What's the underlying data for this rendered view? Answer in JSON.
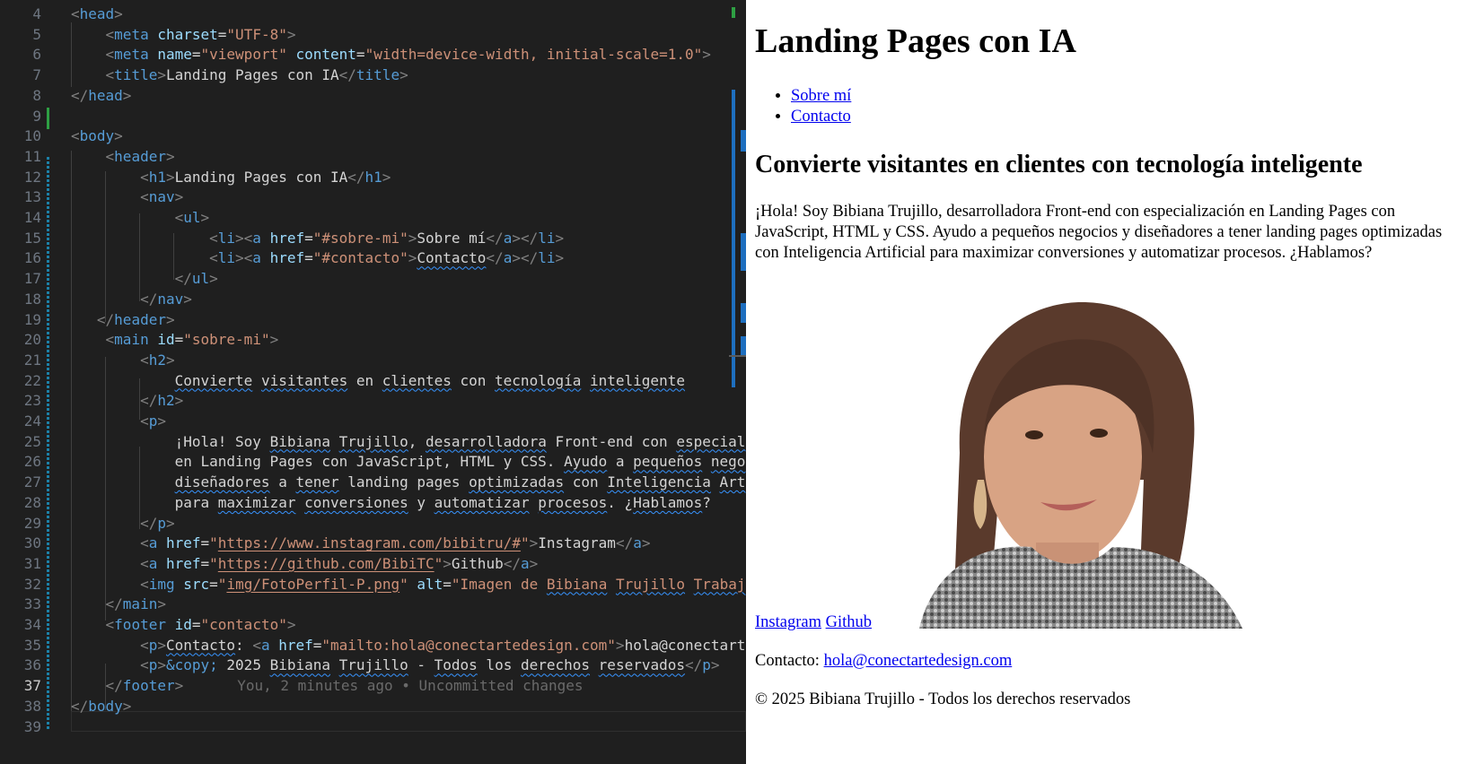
{
  "editor": {
    "active_line": "37",
    "blame": "You, 2 minutes ago • Uncommitted changes",
    "lines": [
      {
        "n": "4",
        "tokens": [
          [
            "t",
            "<"
          ],
          [
            "tn",
            "head"
          ],
          [
            "t",
            ">"
          ]
        ]
      },
      {
        "n": "5",
        "tokens": [
          [
            "tx",
            "    "
          ],
          [
            "t",
            "<"
          ],
          [
            "tn",
            "meta"
          ],
          [
            "tx",
            " "
          ],
          [
            "an",
            "charset"
          ],
          [
            "tx",
            "="
          ],
          [
            "av",
            "\"UTF-8\""
          ],
          [
            "t",
            ">"
          ]
        ]
      },
      {
        "n": "6",
        "tokens": [
          [
            "tx",
            "    "
          ],
          [
            "t",
            "<"
          ],
          [
            "tn",
            "meta"
          ],
          [
            "tx",
            " "
          ],
          [
            "an",
            "name"
          ],
          [
            "tx",
            "="
          ],
          [
            "av",
            "\"viewport\""
          ],
          [
            "tx",
            " "
          ],
          [
            "an",
            "content"
          ],
          [
            "tx",
            "="
          ],
          [
            "av",
            "\"width=device-width, initial-scale=1.0\""
          ],
          [
            "t",
            ">"
          ]
        ]
      },
      {
        "n": "7",
        "tokens": [
          [
            "tx",
            "    "
          ],
          [
            "t",
            "<"
          ],
          [
            "tn",
            "title"
          ],
          [
            "t",
            ">"
          ],
          [
            "tx",
            "Landing Pages con IA"
          ],
          [
            "t",
            "</"
          ],
          [
            "tn",
            "title"
          ],
          [
            "t",
            ">"
          ]
        ]
      },
      {
        "n": "8",
        "tokens": [
          [
            "t",
            "</"
          ],
          [
            "tn",
            "head"
          ],
          [
            "t",
            ">"
          ]
        ]
      },
      {
        "n": "9",
        "tokens": []
      },
      {
        "n": "10",
        "tokens": [
          [
            "t",
            "<"
          ],
          [
            "tn",
            "body"
          ],
          [
            "t",
            ">"
          ]
        ]
      },
      {
        "n": "11",
        "tokens": [
          [
            "tx",
            "    "
          ],
          [
            "t",
            "<"
          ],
          [
            "tn",
            "header"
          ],
          [
            "t",
            ">"
          ]
        ]
      },
      {
        "n": "12",
        "tokens": [
          [
            "tx",
            "        "
          ],
          [
            "t",
            "<"
          ],
          [
            "tn",
            "h1"
          ],
          [
            "t",
            ">"
          ],
          [
            "tx",
            "Landing Pages con IA"
          ],
          [
            "t",
            "</"
          ],
          [
            "tn",
            "h1"
          ],
          [
            "t",
            ">"
          ]
        ]
      },
      {
        "n": "13",
        "tokens": [
          [
            "tx",
            "        "
          ],
          [
            "t",
            "<"
          ],
          [
            "tn",
            "nav"
          ],
          [
            "t",
            ">"
          ]
        ]
      },
      {
        "n": "14",
        "tokens": [
          [
            "tx",
            "            "
          ],
          [
            "t",
            "<"
          ],
          [
            "tn",
            "ul"
          ],
          [
            "t",
            ">"
          ]
        ]
      },
      {
        "n": "15",
        "tokens": [
          [
            "tx",
            "                "
          ],
          [
            "t",
            "<"
          ],
          [
            "tn",
            "li"
          ],
          [
            "t",
            "><"
          ],
          [
            "tn",
            "a"
          ],
          [
            "tx",
            " "
          ],
          [
            "an",
            "href"
          ],
          [
            "tx",
            "="
          ],
          [
            "av",
            "\"#sobre-mi\""
          ],
          [
            "t",
            ">"
          ],
          [
            "tx",
            "Sobre mí"
          ],
          [
            "t",
            "</"
          ],
          [
            "tn",
            "a"
          ],
          [
            "t",
            "></"
          ],
          [
            "tn",
            "li"
          ],
          [
            "t",
            ">"
          ]
        ]
      },
      {
        "n": "16",
        "tokens": [
          [
            "tx",
            "                "
          ],
          [
            "t",
            "<"
          ],
          [
            "tn",
            "li"
          ],
          [
            "t",
            "><"
          ],
          [
            "tn",
            "a"
          ],
          [
            "tx",
            " "
          ],
          [
            "an",
            "href"
          ],
          [
            "tx",
            "="
          ],
          [
            "av",
            "\"#contacto\""
          ],
          [
            "t",
            ">"
          ],
          [
            "sq",
            "Contacto"
          ],
          [
            "t",
            "</"
          ],
          [
            "tn",
            "a"
          ],
          [
            "t",
            "></"
          ],
          [
            "tn",
            "li"
          ],
          [
            "t",
            ">"
          ]
        ]
      },
      {
        "n": "17",
        "tokens": [
          [
            "tx",
            "            "
          ],
          [
            "t",
            "</"
          ],
          [
            "tn",
            "ul"
          ],
          [
            "t",
            ">"
          ]
        ]
      },
      {
        "n": "18",
        "tokens": [
          [
            "tx",
            "        "
          ],
          [
            "t",
            "</"
          ],
          [
            "tn",
            "nav"
          ],
          [
            "t",
            ">"
          ]
        ]
      },
      {
        "n": "19",
        "tokens": [
          [
            "tx",
            "   "
          ],
          [
            "t",
            "</"
          ],
          [
            "tn",
            "header"
          ],
          [
            "t",
            ">"
          ]
        ]
      },
      {
        "n": "20",
        "tokens": [
          [
            "tx",
            "    "
          ],
          [
            "t",
            "<"
          ],
          [
            "tn",
            "main"
          ],
          [
            "tx",
            " "
          ],
          [
            "an",
            "id"
          ],
          [
            "tx",
            "="
          ],
          [
            "av",
            "\"sobre-mi\""
          ],
          [
            "t",
            ">"
          ]
        ]
      },
      {
        "n": "21",
        "tokens": [
          [
            "tx",
            "        "
          ],
          [
            "t",
            "<"
          ],
          [
            "tn",
            "h2"
          ],
          [
            "t",
            ">"
          ]
        ]
      },
      {
        "n": "22",
        "tokens": [
          [
            "tx",
            "            "
          ],
          [
            "sq",
            "Convierte"
          ],
          [
            "tx",
            " "
          ],
          [
            "sq",
            "visitantes"
          ],
          [
            "tx",
            " en "
          ],
          [
            "sq",
            "clientes"
          ],
          [
            "tx",
            " con "
          ],
          [
            "sq",
            "tecnología"
          ],
          [
            "tx",
            " "
          ],
          [
            "sq",
            "inteligente"
          ]
        ]
      },
      {
        "n": "23",
        "tokens": [
          [
            "tx",
            "        "
          ],
          [
            "t",
            "</"
          ],
          [
            "tn",
            "h2"
          ],
          [
            "t",
            ">"
          ]
        ]
      },
      {
        "n": "24",
        "tokens": [
          [
            "tx",
            "        "
          ],
          [
            "t",
            "<"
          ],
          [
            "tn",
            "p"
          ],
          [
            "t",
            ">"
          ]
        ]
      },
      {
        "n": "25",
        "tokens": [
          [
            "tx",
            "            ¡Hola! Soy "
          ],
          [
            "sq",
            "Bibiana"
          ],
          [
            "tx",
            " "
          ],
          [
            "sq",
            "Trujillo"
          ],
          [
            "tx",
            ", "
          ],
          [
            "sq",
            "desarrolladora"
          ],
          [
            "tx",
            " Front-end con "
          ],
          [
            "sq",
            "especial"
          ]
        ]
      },
      {
        "n": "26",
        "tokens": [
          [
            "tx",
            "            en Landing Pages con JavaScript, HTML y CSS. "
          ],
          [
            "sq",
            "Ayudo"
          ],
          [
            "tx",
            " a "
          ],
          [
            "sq",
            "pequeños"
          ],
          [
            "tx",
            " "
          ],
          [
            "sq",
            "nego"
          ]
        ]
      },
      {
        "n": "27",
        "tokens": [
          [
            "tx",
            "            "
          ],
          [
            "sq",
            "diseñadores"
          ],
          [
            "tx",
            " a "
          ],
          [
            "sq",
            "tener"
          ],
          [
            "tx",
            " landing pages "
          ],
          [
            "sq",
            "optimizadas"
          ],
          [
            "tx",
            " con "
          ],
          [
            "sq",
            "Inteligencia"
          ],
          [
            "tx",
            " "
          ],
          [
            "sq",
            "Art"
          ]
        ]
      },
      {
        "n": "28",
        "tokens": [
          [
            "tx",
            "            para "
          ],
          [
            "sq",
            "maximizar"
          ],
          [
            "tx",
            " "
          ],
          [
            "sq",
            "conversiones"
          ],
          [
            "tx",
            " y "
          ],
          [
            "sq",
            "automatizar"
          ],
          [
            "tx",
            " "
          ],
          [
            "sq",
            "procesos"
          ],
          [
            "tx",
            ". ¿"
          ],
          [
            "sq",
            "Hablamos"
          ],
          [
            "tx",
            "?"
          ]
        ]
      },
      {
        "n": "29",
        "tokens": [
          [
            "tx",
            "        "
          ],
          [
            "t",
            "</"
          ],
          [
            "tn",
            "p"
          ],
          [
            "t",
            ">"
          ]
        ]
      },
      {
        "n": "30",
        "tokens": [
          [
            "tx",
            "        "
          ],
          [
            "t",
            "<"
          ],
          [
            "tn",
            "a"
          ],
          [
            "tx",
            " "
          ],
          [
            "an",
            "href"
          ],
          [
            "tx",
            "="
          ],
          [
            "av",
            "\""
          ],
          [
            "avl",
            "https://www.instagram.com/bibitru/#"
          ],
          [
            "av",
            "\""
          ],
          [
            "t",
            ">"
          ],
          [
            "tx",
            "Instagram"
          ],
          [
            "t",
            "</"
          ],
          [
            "tn",
            "a"
          ],
          [
            "t",
            ">"
          ]
        ]
      },
      {
        "n": "31",
        "tokens": [
          [
            "tx",
            "        "
          ],
          [
            "t",
            "<"
          ],
          [
            "tn",
            "a"
          ],
          [
            "tx",
            " "
          ],
          [
            "an",
            "href"
          ],
          [
            "tx",
            "="
          ],
          [
            "av",
            "\""
          ],
          [
            "avl",
            "https://github.com/BibiTC"
          ],
          [
            "av",
            "\""
          ],
          [
            "t",
            ">"
          ],
          [
            "tx",
            "Github"
          ],
          [
            "t",
            "</"
          ],
          [
            "tn",
            "a"
          ],
          [
            "t",
            ">"
          ]
        ]
      },
      {
        "n": "32",
        "tokens": [
          [
            "tx",
            "        "
          ],
          [
            "t",
            "<"
          ],
          [
            "tn",
            "img"
          ],
          [
            "tx",
            " "
          ],
          [
            "an",
            "src"
          ],
          [
            "tx",
            "="
          ],
          [
            "av",
            "\""
          ],
          [
            "avl",
            "img/FotoPerfil-P.png"
          ],
          [
            "av",
            "\""
          ],
          [
            "tx",
            " "
          ],
          [
            "an",
            "alt"
          ],
          [
            "tx",
            "="
          ],
          [
            "av",
            "\"Imagen de "
          ],
          [
            "avs",
            "Bibiana"
          ],
          [
            "av",
            " "
          ],
          [
            "avs",
            "Trujillo"
          ],
          [
            "av",
            " "
          ],
          [
            "avs",
            "Trabaj"
          ]
        ]
      },
      {
        "n": "33",
        "tokens": [
          [
            "tx",
            "    "
          ],
          [
            "t",
            "</"
          ],
          [
            "tn",
            "main"
          ],
          [
            "t",
            ">"
          ]
        ]
      },
      {
        "n": "34",
        "tokens": [
          [
            "tx",
            "    "
          ],
          [
            "t",
            "<"
          ],
          [
            "tn",
            "footer"
          ],
          [
            "tx",
            " "
          ],
          [
            "an",
            "id"
          ],
          [
            "tx",
            "="
          ],
          [
            "av",
            "\"contacto\""
          ],
          [
            "t",
            ">"
          ]
        ]
      },
      {
        "n": "35",
        "tokens": [
          [
            "tx",
            "        "
          ],
          [
            "t",
            "<"
          ],
          [
            "tn",
            "p"
          ],
          [
            "t",
            ">"
          ],
          [
            "sq",
            "Contacto"
          ],
          [
            "tx",
            ": "
          ],
          [
            "t",
            "<"
          ],
          [
            "tn",
            "a"
          ],
          [
            "tx",
            " "
          ],
          [
            "an",
            "href"
          ],
          [
            "tx",
            "="
          ],
          [
            "av",
            "\"mailto:hola@conectartedesign.com\""
          ],
          [
            "t",
            ">"
          ],
          [
            "tx",
            "hola@conectart"
          ]
        ]
      },
      {
        "n": "36",
        "tokens": [
          [
            "tx",
            "        "
          ],
          [
            "t",
            "<"
          ],
          [
            "tn",
            "p"
          ],
          [
            "t",
            ">"
          ],
          [
            "en",
            "&copy;"
          ],
          [
            "tx",
            " 2025 "
          ],
          [
            "sq",
            "Bibiana"
          ],
          [
            "tx",
            " "
          ],
          [
            "sq",
            "Trujillo"
          ],
          [
            "tx",
            " - "
          ],
          [
            "sq",
            "Todos"
          ],
          [
            "tx",
            " los "
          ],
          [
            "sq",
            "derechos"
          ],
          [
            "tx",
            " "
          ],
          [
            "sq",
            "reservados"
          ],
          [
            "t",
            "</"
          ],
          [
            "tn",
            "p"
          ],
          [
            "t",
            ">"
          ]
        ]
      },
      {
        "n": "37",
        "tokens": [
          [
            "tx",
            "    "
          ],
          [
            "t",
            "</"
          ],
          [
            "tn",
            "footer"
          ],
          [
            "t",
            ">"
          ]
        ]
      },
      {
        "n": "38",
        "tokens": [
          [
            "t",
            "</"
          ],
          [
            "tn",
            "body"
          ],
          [
            "t",
            ">"
          ]
        ]
      },
      {
        "n": "39",
        "tokens": []
      }
    ]
  },
  "preview": {
    "h1": "Landing Pages con IA",
    "nav": [
      "Sobre mí",
      "Contacto"
    ],
    "h2": "Convierte visitantes en clientes con tecnología inteligente",
    "intro": "¡Hola! Soy Bibiana Trujillo, desarrolladora Front-end con especialización en Landing Pages con JavaScript, HTML y CSS. Ayudo a pequeños negocios y diseñadores a tener landing pages optimizadas con Inteligencia Artificial para maximizar conversiones y automatizar procesos. ¿Hablamos?",
    "instagram": "Instagram",
    "github": "Github",
    "contact_label": "Contacto: ",
    "contact_email": "hola@conectartedesign.com",
    "copyright": "© 2025 Bibiana Trujillo - Todos los derechos reservados"
  },
  "colors": {
    "editor_bg": "#1f1f1f",
    "tag": "#569cd6",
    "attr_name": "#9cdcfe",
    "attr_value": "#ce9178",
    "text": "#d4d4d4",
    "link": "#0000ee"
  }
}
